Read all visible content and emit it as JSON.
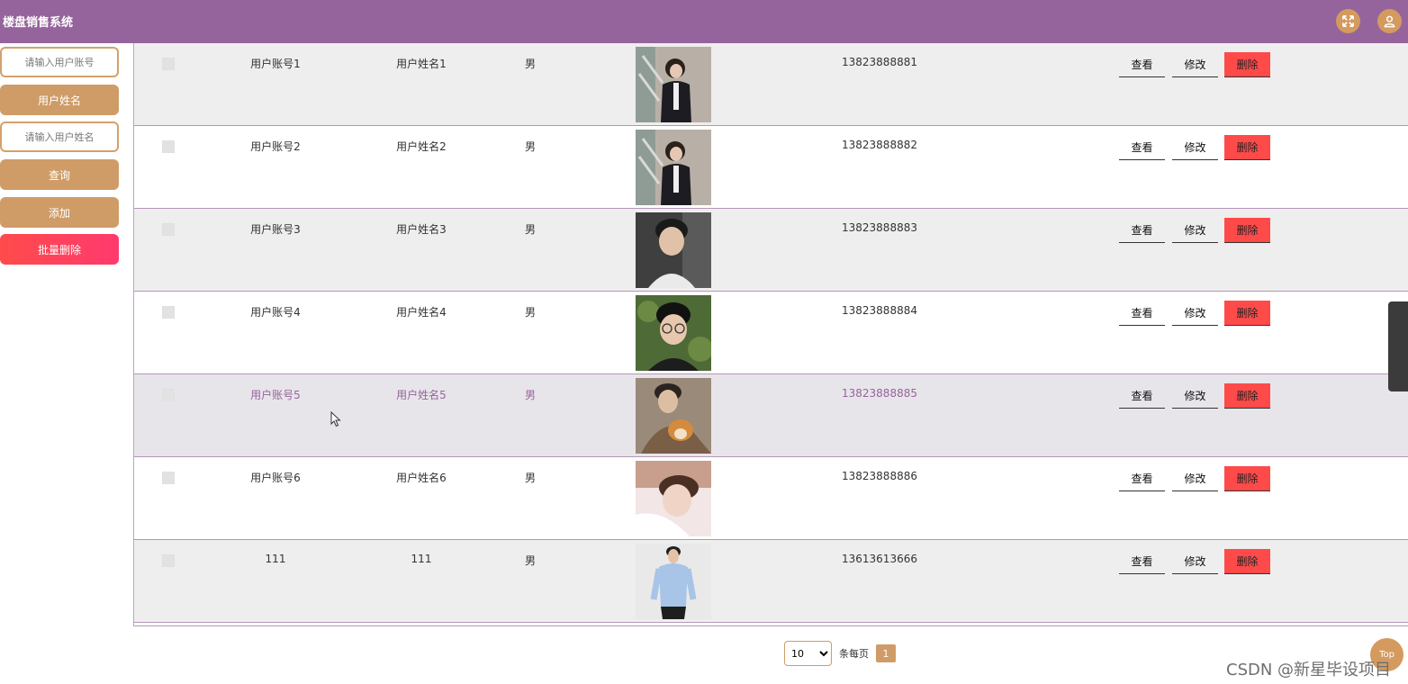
{
  "app": {
    "title": "楼盘销售系统"
  },
  "header": {
    "icons": [
      "fullscreen-icon",
      "user-icon"
    ]
  },
  "sidebar": {
    "account_input_placeholder": "请输入用户账号",
    "name_label": "用户姓名",
    "name_input_placeholder": "请输入用户姓名",
    "search_label": "查询",
    "add_label": "添加",
    "batch_delete_label": "批量删除"
  },
  "table": {
    "rows": [
      {
        "account": "用户账号1",
        "name": "用户姓名1",
        "sex": "男",
        "phone": "13823888881",
        "view": "查看",
        "edit": "修改",
        "delete": "删除"
      },
      {
        "account": "用户账号2",
        "name": "用户姓名2",
        "sex": "男",
        "phone": "13823888882",
        "view": "查看",
        "edit": "修改",
        "delete": "删除"
      },
      {
        "account": "用户账号3",
        "name": "用户姓名3",
        "sex": "男",
        "phone": "13823888883",
        "view": "查看",
        "edit": "修改",
        "delete": "删除"
      },
      {
        "account": "用户账号4",
        "name": "用户姓名4",
        "sex": "男",
        "phone": "13823888884",
        "view": "查看",
        "edit": "修改",
        "delete": "删除"
      },
      {
        "account": "用户账号5",
        "name": "用户姓名5",
        "sex": "男",
        "phone": "13823888885",
        "view": "查看",
        "edit": "修改",
        "delete": "删除"
      },
      {
        "account": "用户账号6",
        "name": "用户姓名6",
        "sex": "男",
        "phone": "13823888886",
        "view": "查看",
        "edit": "修改",
        "delete": "删除"
      },
      {
        "account": "111",
        "name": "111",
        "sex": "男",
        "phone": "13613613666",
        "view": "查看",
        "edit": "修改",
        "delete": "删除"
      }
    ]
  },
  "pagination": {
    "page_size": "10",
    "page_size_options": [
      "10"
    ],
    "per_page_label": "条每页",
    "current_page": "1"
  },
  "back_to_top": {
    "label": "Top"
  },
  "watermark": "CSDN @新星毕设项目",
  "colors": {
    "header": "#96649c",
    "accent": "#cf9c67",
    "danger": "#ff4a4a"
  }
}
